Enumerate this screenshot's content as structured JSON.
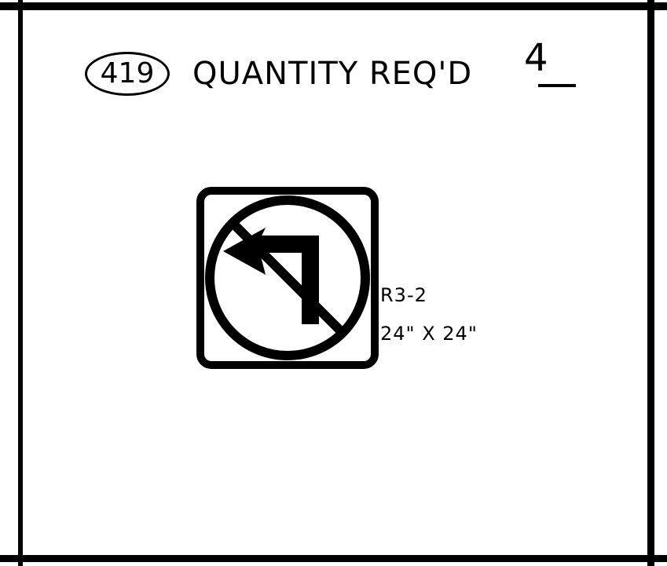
{
  "header": {
    "item_number": "419",
    "quantity_label": "QUANTITY REQ'D",
    "quantity_value": "4"
  },
  "sign": {
    "code": "R3-2",
    "size": "24\" X 24\"",
    "icon": "no-left-turn-icon",
    "colors": {
      "symbol": "#000000",
      "background": "#ffffff"
    }
  }
}
